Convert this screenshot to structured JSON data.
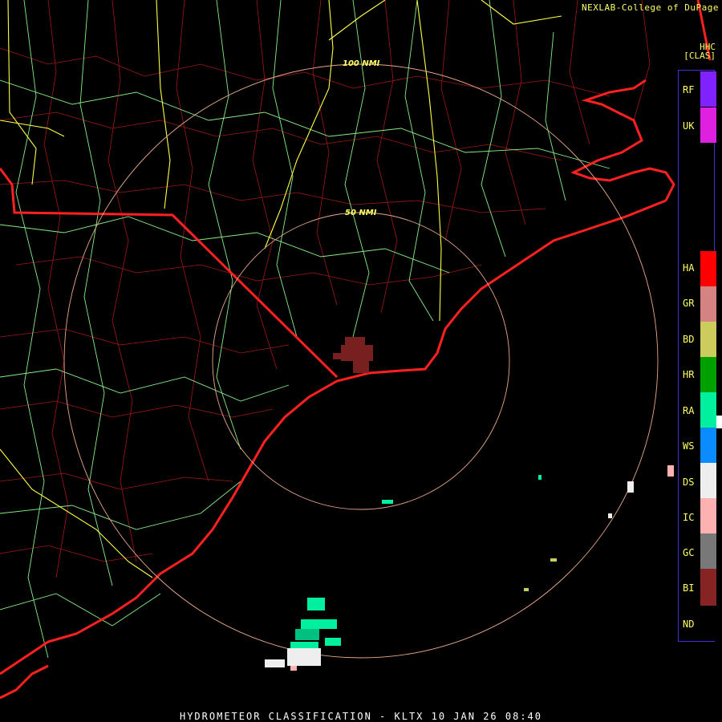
{
  "header": {
    "credit": "NEXLAB-College of DuPage",
    "product_code": "HHC",
    "product_name": "[CLAS]"
  },
  "footer": {
    "title": "HYDROMETEOR CLASSIFICATION - KLTX 10 JAN 26 08:40"
  },
  "range_rings": [
    {
      "label": "50 NMI"
    },
    {
      "label": "100 NMI"
    }
  ],
  "legend": [
    {
      "code": "RF",
      "color": "#7f22ff"
    },
    {
      "code": "UK",
      "color": "#e020e0"
    },
    {
      "code": "HA",
      "color": "#ff0000"
    },
    {
      "code": "GR",
      "color": "#d48282"
    },
    {
      "code": "BD",
      "color": "#cccc5c"
    },
    {
      "code": "HR",
      "color": "#00a000"
    },
    {
      "code": "RA",
      "color": "#00f0a0"
    },
    {
      "code": "WS",
      "color": "#0a8cff"
    },
    {
      "code": "DS",
      "color": "#eeeeee"
    },
    {
      "code": "IC",
      "color": "#ffb0b0"
    },
    {
      "code": "GC",
      "color": "#787878"
    },
    {
      "code": "BI",
      "color": "#862424"
    },
    {
      "code": "ND",
      "color": "#000000"
    }
  ],
  "colors": {
    "state_border": "#ff2020",
    "county_border": "#a01818",
    "highway": "#88ee88",
    "interstate": "#ffff44",
    "range_ring": "#e8a888"
  }
}
